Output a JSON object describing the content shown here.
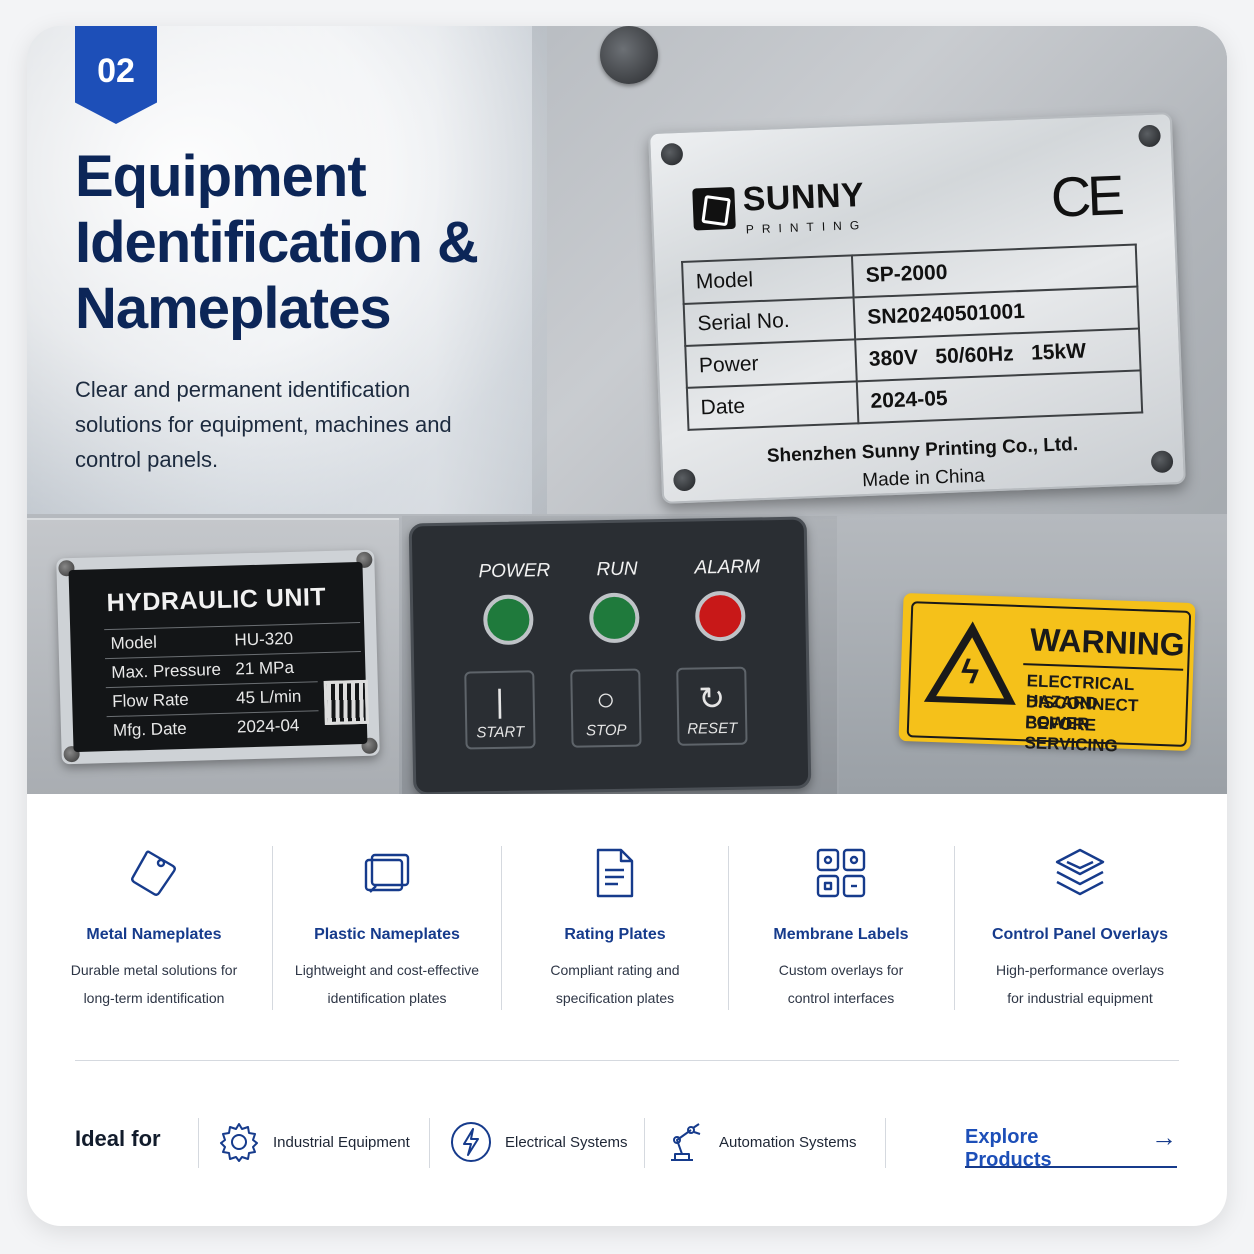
{
  "badge": "02",
  "hero": {
    "title": "Equipment Identification & Nameplates",
    "subtitle": "Clear and permanent identification solutions for equipment, machines and control panels."
  },
  "nameplate": {
    "brand": "SUNNY",
    "brand_sub": "PRINTING",
    "mark": "CE",
    "rows": [
      {
        "label": "Model",
        "value": "SP-2000"
      },
      {
        "label": "Serial No.",
        "value": "SN20240501001"
      },
      {
        "label": "Power",
        "value": "380V   50/60Hz   15kW"
      },
      {
        "label": "Date",
        "value": "2024-05"
      }
    ],
    "footer_company": "Shenzhen Sunny Printing Co., Ltd.",
    "footer_origin": "Made in China"
  },
  "hydraulic": {
    "title": "HYDRAULIC UNIT",
    "rows": [
      {
        "label": "Model",
        "value": "HU-320"
      },
      {
        "label": "Max. Pressure",
        "value": "21 MPa"
      },
      {
        "label": "Flow Rate",
        "value": "45 L/min"
      },
      {
        "label": "Mfg. Date",
        "value": "2024-04"
      }
    ]
  },
  "control_panel": {
    "lights": [
      {
        "label": "POWER",
        "color": "#1f7a3c"
      },
      {
        "label": "RUN",
        "color": "#1f7a3c"
      },
      {
        "label": "ALARM",
        "color": "#c81818"
      }
    ],
    "buttons": [
      {
        "symbol": "|",
        "label": "START"
      },
      {
        "symbol": "○",
        "label": "STOP"
      },
      {
        "symbol": "↻",
        "label": "RESET"
      }
    ]
  },
  "warning": {
    "title": "WARNING",
    "lines": [
      "ELECTRICAL HAZARD",
      "DISCONNECT POWER",
      "BEFORE SERVICING"
    ]
  },
  "features": [
    {
      "icon": "tag-icon",
      "title": "Metal Nameplates",
      "desc1": "Durable metal solutions for",
      "desc2": "long-term identification"
    },
    {
      "icon": "layers-cards-icon",
      "title": "Plastic Nameplates",
      "desc1": "Lightweight and cost-effective",
      "desc2": "identification plates"
    },
    {
      "icon": "document-icon",
      "title": "Rating Plates",
      "desc1": "Compliant rating and",
      "desc2": "specification plates"
    },
    {
      "icon": "grid-panel-icon",
      "title": "Membrane Labels",
      "desc1": "Custom overlays for",
      "desc2": "control interfaces"
    },
    {
      "icon": "stack-layers-icon",
      "title": "Control Panel Overlays",
      "desc1": "High-performance overlays",
      "desc2": "for industrial equipment"
    }
  ],
  "ideal_for": {
    "label": "Ideal for",
    "items": [
      {
        "icon": "gear-icon",
        "label": "Industrial Equipment"
      },
      {
        "icon": "bolt-icon",
        "label": "Electrical Systems"
      },
      {
        "icon": "robot-arm-icon",
        "label": "Automation Systems"
      }
    ]
  },
  "cta": {
    "label": "Explore Products"
  },
  "colors": {
    "accent": "#1d4fb8",
    "navy": "#0c2658",
    "warning": "#f5c11a"
  }
}
